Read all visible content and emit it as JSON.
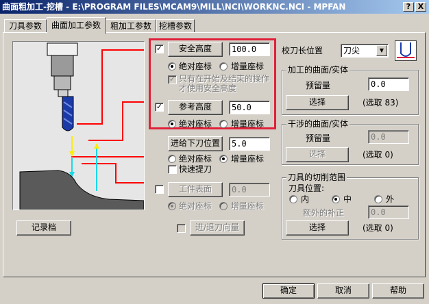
{
  "window": {
    "title": "曲面粗加工-挖槽 - E:\\PROGRAM FILES\\MCAM9\\MILL\\NCI\\WORKNC.NCI - MPFAN",
    "help_btn": "?",
    "close_btn": "X"
  },
  "tabs": [
    {
      "label": "刀具参数"
    },
    {
      "label": "曲面加工参数"
    },
    {
      "label": "粗加工参数"
    },
    {
      "label": "挖槽参数"
    }
  ],
  "left": {
    "safe_height": {
      "checked": "✓",
      "button": "安全高度",
      "value": "100.0"
    },
    "safe_coords": {
      "absolute": "绝对座标",
      "incremental": "增量座标"
    },
    "safe_only_start_end": {
      "checked": "✓",
      "label_line1": "只有在开始及结束的操作",
      "label_line2": "才使用安全高度"
    },
    "ref_height": {
      "checked": "✓",
      "button": "参考高度",
      "value": "50.0"
    },
    "ref_coords": {
      "absolute": "绝对座标",
      "incremental": "增量座标"
    },
    "feed_plane": {
      "button": "进给下刀位置",
      "value": "5.0"
    },
    "feed_coords": {
      "absolute": "绝对座标",
      "incremental": "增量座标"
    },
    "rapid_retract": {
      "label": "快速提刀"
    },
    "top_stock": {
      "button": "工件表面",
      "value": "0.0"
    },
    "top_coords": {
      "absolute": "绝对座标",
      "incremental": "增量座标"
    },
    "record_btn": "记录档",
    "entry_exit_btn": "进/退刀向量"
  },
  "right": {
    "tip_comp": {
      "label": "校刀长位置",
      "selected": "刀尖"
    },
    "drive_surfaces": {
      "title": "加工的曲面/实体",
      "stock_label": "预留量",
      "stock_value": "0.0",
      "select_btn": "选择",
      "count": "(选取 83)"
    },
    "check_surfaces": {
      "title": "干涉的曲面/实体",
      "stock_label": "预留量",
      "stock_value": "0.0",
      "select_btn": "选择",
      "count": "(选取 0)"
    },
    "boundary": {
      "title": "刀具的切削范围",
      "position_label": "刀具位置:",
      "inside": "内",
      "center": "中",
      "outside": "外",
      "offset_label": "额外的补正",
      "offset_value": "0.0",
      "select_btn": "选择",
      "count": "(选取 0)"
    }
  },
  "footer": {
    "ok": "确定",
    "cancel": "取消",
    "help": "帮助"
  },
  "colors": {
    "highlight_frame": "#e0203a",
    "title_bar": "#0a246a",
    "tool_flute": "#1a3aa8",
    "diagram_line": "#ff0000",
    "arrow_yellow": "#ffee00",
    "arrow_cyan": "#18d8e8"
  }
}
